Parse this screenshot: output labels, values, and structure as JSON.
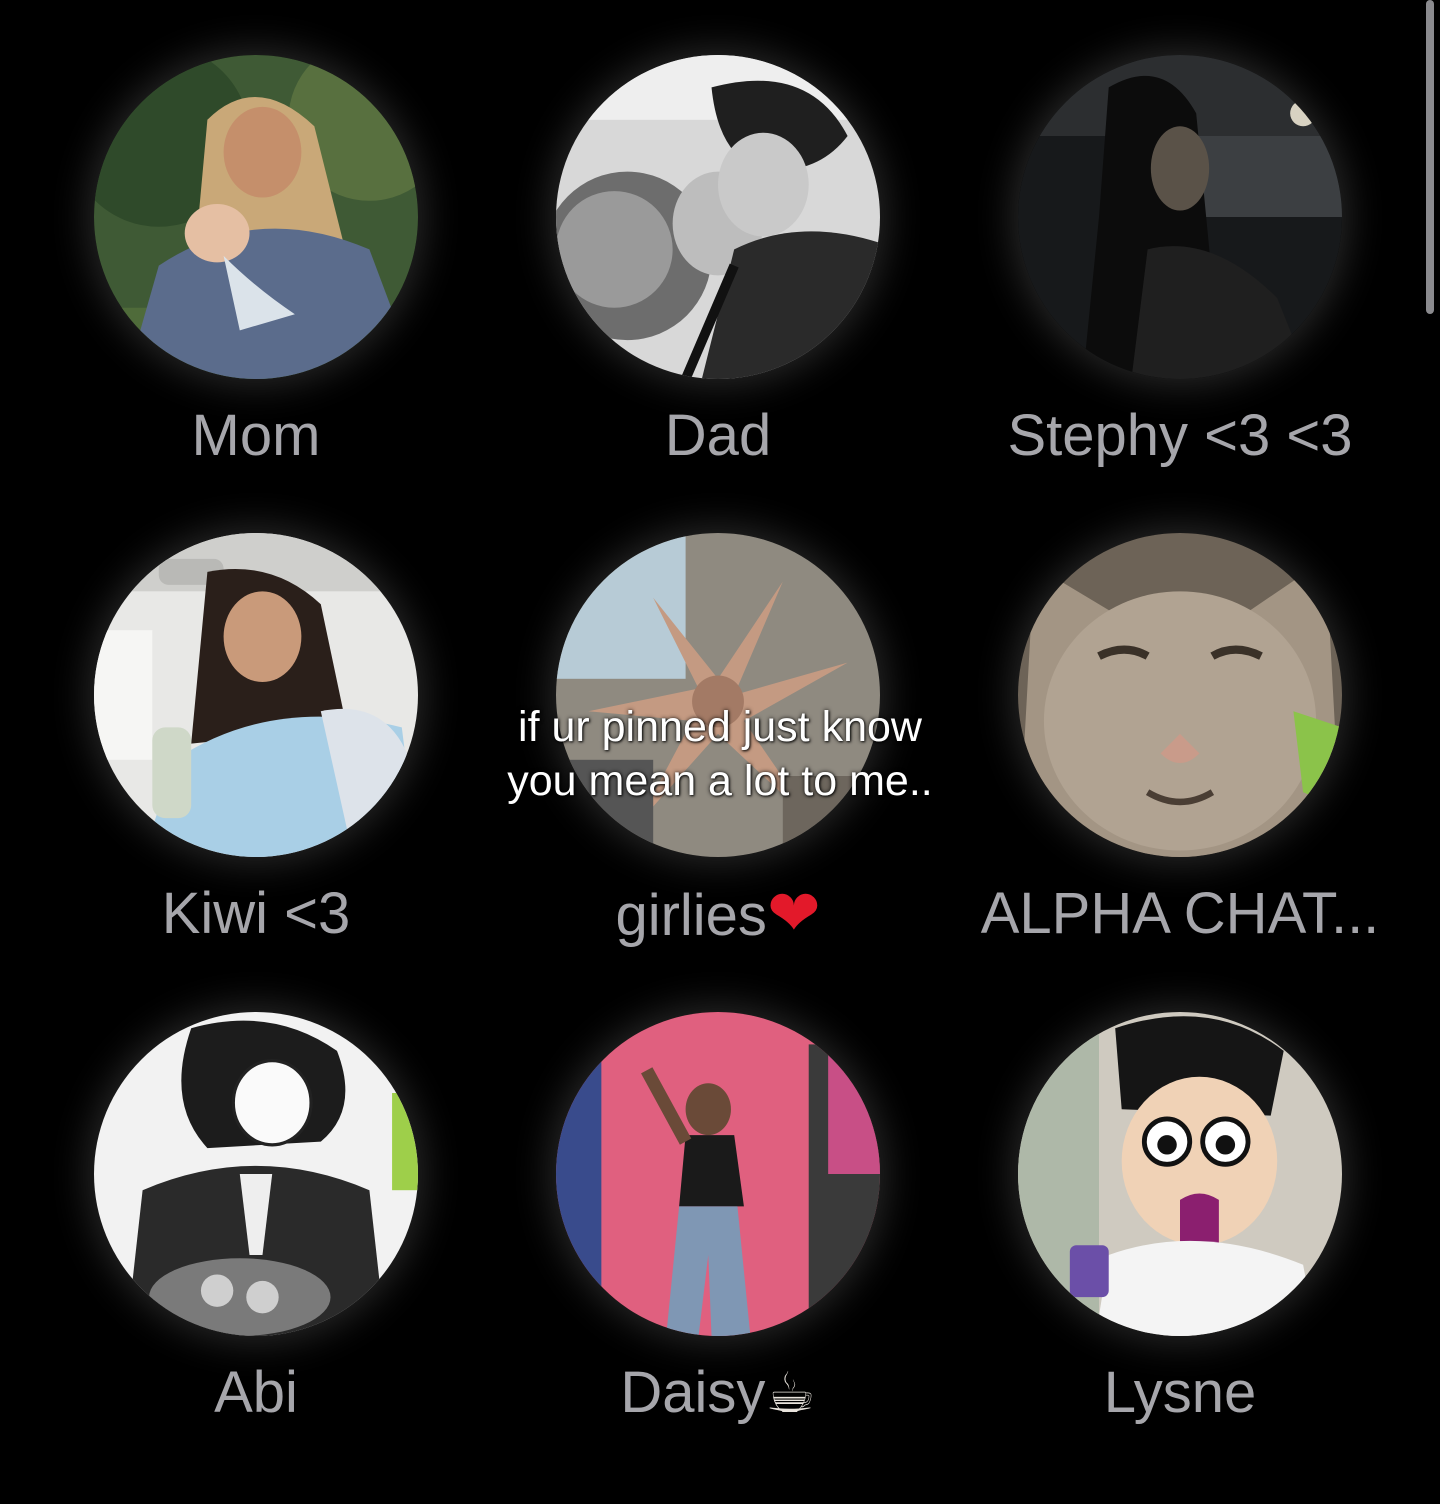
{
  "contacts": [
    {
      "name": "Mom",
      "emoji": "",
      "avatar_icon": "mother-holding-baby-photo-icon"
    },
    {
      "name": "Dad",
      "emoji": "",
      "avatar_icon": "couple-kissing-bw-photo-icon"
    },
    {
      "name": "Stephy <3 <3",
      "emoji": "",
      "avatar_icon": "girl-in-car-night-photo-icon"
    },
    {
      "name": "Kiwi <3",
      "emoji": "",
      "avatar_icon": "girl-laughing-in-car-photo-icon"
    },
    {
      "name": "girlies",
      "emoji": "❤",
      "avatar_icon": "hands-star-shape-photo-icon"
    },
    {
      "name": "ALPHA CHAT...",
      "emoji": "",
      "avatar_icon": "cat-face-photo-icon"
    },
    {
      "name": "Abi",
      "emoji": "",
      "avatar_icon": "manga-character-flowers-icon"
    },
    {
      "name": "Daisy",
      "emoji": "☕",
      "avatar_icon": "girl-posing-pink-wall-photo-icon"
    },
    {
      "name": "Lysne",
      "emoji": "",
      "avatar_icon": "anime-character-shocked-icon"
    }
  ],
  "overlay": {
    "line1": "if ur pinned just know",
    "line2": "you mean a lot to me.."
  },
  "colors": {
    "background": "#000000",
    "name_text": "#a6a6ab",
    "overlay_text": "#ffffff"
  }
}
